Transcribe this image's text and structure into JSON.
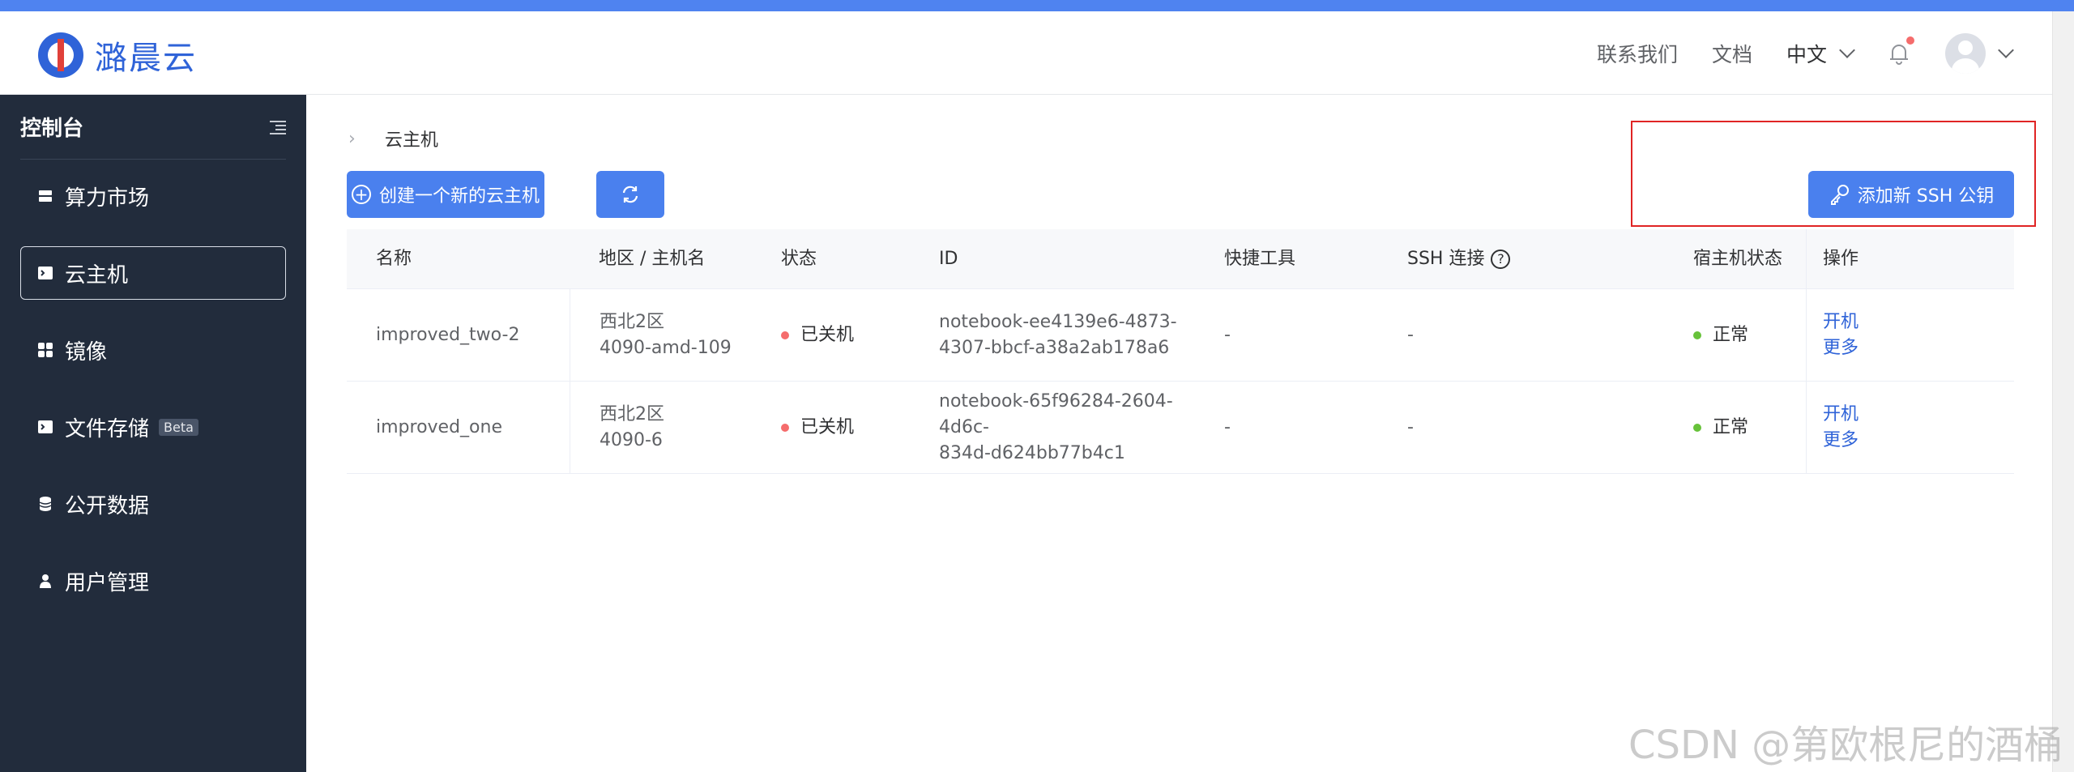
{
  "brand": {
    "name": "潞晨云"
  },
  "header": {
    "links": [
      "联系我们",
      "文档"
    ],
    "language": "中文"
  },
  "sidebar": {
    "title": "控制台",
    "items": [
      {
        "label": "算力市场",
        "icon": "server-icon"
      },
      {
        "label": "云主机",
        "icon": "terminal-icon",
        "active": true
      },
      {
        "label": "镜像",
        "icon": "grid-icon"
      },
      {
        "label": "文件存储",
        "icon": "terminal-icon",
        "badge": "Beta"
      },
      {
        "label": "公开数据",
        "icon": "database-icon"
      },
      {
        "label": "用户管理",
        "icon": "user-icon"
      }
    ]
  },
  "breadcrumb": {
    "current": "云主机"
  },
  "toolbar": {
    "create_label": "创建一个新的云主机",
    "ssh_label": "添加新 SSH 公钥"
  },
  "table": {
    "columns": [
      "名称",
      "地区 / 主机名",
      "状态",
      "ID",
      "快捷工具",
      "SSH 连接",
      "宿主机状态",
      "操作"
    ],
    "rows": [
      {
        "name": "improved_two-2",
        "region": "西北2区",
        "host": "4090-amd-109",
        "status": "已关机",
        "id_line1": "notebook-ee4139e6-4873-",
        "id_line2": "4307-bbcf-a38a2ab178a6",
        "tools": "-",
        "ssh": "-",
        "host_status": "正常",
        "op_start": "开机",
        "op_more": "更多"
      },
      {
        "name": "improved_one",
        "region": "西北2区",
        "host": "4090-6",
        "status": "已关机",
        "id_line1": "notebook-65f96284-2604-4d6c-",
        "id_line2": "834d-d624bb77b4c1",
        "tools": "-",
        "ssh": "-",
        "host_status": "正常",
        "op_start": "开机",
        "op_more": "更多"
      }
    ]
  },
  "watermark": "CSDN @第欧根尼的酒桶",
  "colors": {
    "primary": "#4a80ee",
    "sidebar_bg": "#222c3c",
    "highlight": "#e02424",
    "stopped": "#f56c6c",
    "normal": "#67c23a"
  }
}
